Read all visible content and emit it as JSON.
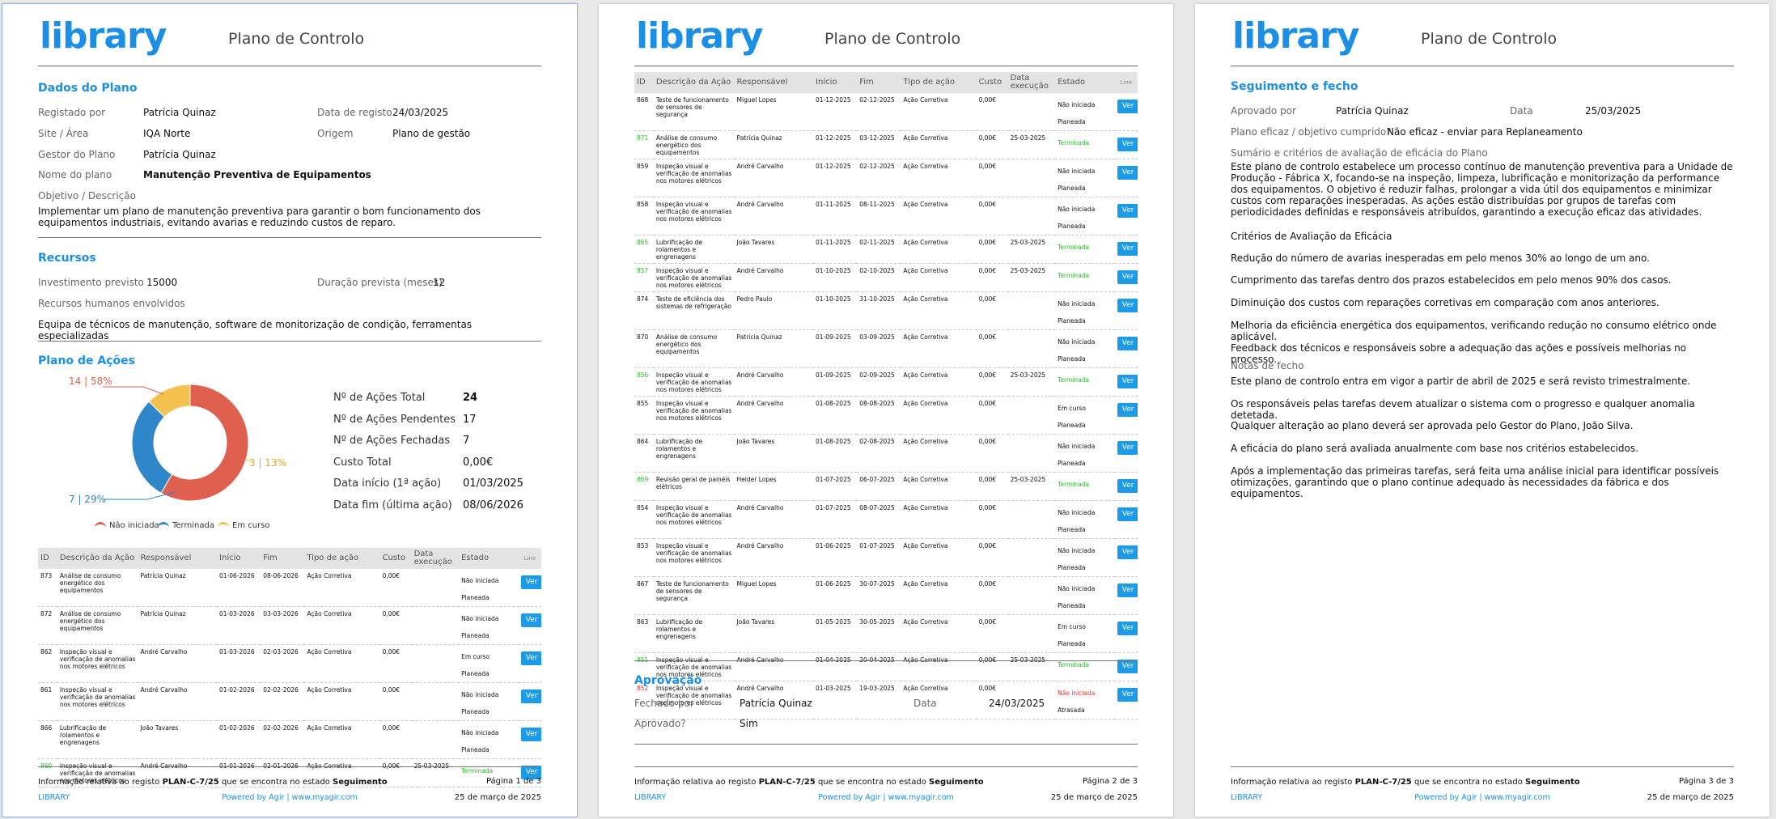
{
  "doc": {
    "logo": "library",
    "title": "Plano de Controlo",
    "footer": {
      "info_prefix": "Informação relativa ao registo ",
      "code": "PLAN-C-7/25",
      "info_mid": " que se encontra no estado ",
      "state": "Seguimento",
      "lib": "LIBRARY",
      "powered": "Powered by Agir | www.myagir.com",
      "date": "25 de março de 2025",
      "pages": [
        "Página 1 de 3",
        "Página 2 de 3",
        "Página 3 de 3"
      ]
    }
  },
  "dados": {
    "title": "Dados do Plano",
    "registado_por_label": "Registado por",
    "registado_por": "Patrícia Quinaz",
    "data_registo_label": "Data de registo",
    "data_registo": "24/03/2025",
    "site_label": "Site / Área",
    "site": "IQA Norte",
    "origem_label": "Origem",
    "origem": "Plano de gestão",
    "gestor_label": "Gestor do Plano",
    "gestor": "Patrícia Quinaz",
    "nome_label": "Nome do plano",
    "nome": "Manutenção Preventiva de Equipamentos",
    "objetivo_label": "Objetivo / Descrição",
    "objetivo": "Implementar um plano de manutenção preventiva para garantir o bom funcionamento dos equipamentos industriais, evitando avarias e reduzindo custos de reparo."
  },
  "recursos": {
    "title": "Recursos",
    "investimento_label": "Investimento previsto",
    "investimento": "15000",
    "duracao_label": "Duração prevista (meses)",
    "duracao": "12",
    "humanos_label": "Recursos humanos envolvidos",
    "humanos": "Equipa de técnicos de manutenção, software de monitorização de condição, ferramentas especializadas"
  },
  "plano_acoes": {
    "title": "Plano de Ações",
    "stats": [
      {
        "label": "Nº de Ações Total",
        "value": "24"
      },
      {
        "label": "Nº de Ações Pendentes",
        "value": "17"
      },
      {
        "label": "Nº de Ações Fechadas",
        "value": "7"
      },
      {
        "label": "Custo Total",
        "value": "0,00€"
      },
      {
        "label": "Data início (1ª ação)",
        "value": "01/03/2025"
      },
      {
        "label": "Data fim (última ação)",
        "value": "08/06/2026"
      }
    ],
    "legend": [
      "Não iniciada",
      "Terminada",
      "Em curso"
    ]
  },
  "chart_data": {
    "type": "pie",
    "categories": [
      "Não iniciada",
      "Terminada",
      "Em curso"
    ],
    "values": [
      14,
      7,
      3
    ],
    "labels": [
      "14 | 58%",
      "7 | 29%",
      "3 | 13%"
    ],
    "colors": [
      "#e0604f",
      "#2f86c8",
      "#f2c14e"
    ]
  },
  "table": {
    "headers": [
      "ID",
      "Descrição da Ação",
      "Responsável",
      "Início",
      "Fim",
      "Tipo de ação",
      "Custo",
      "Data execução",
      "Estado",
      "Line"
    ],
    "button": "Ver",
    "rows_p1": [
      {
        "id": "873",
        "desc": "Análise de consumo energético dos equipamentos",
        "resp": "Patrícia Quinaz",
        "ini": "01-06-2026",
        "fim": "08-06-2026",
        "tipo": "Ação Corretiva",
        "custo": "0,00€",
        "exec": "",
        "estado": "Não iniciada",
        "sub": "Planeada",
        "cls": ""
      },
      {
        "id": "872",
        "desc": "Análise de consumo energético dos equipamentos",
        "resp": "Patrícia Quinaz",
        "ini": "01-03-2026",
        "fim": "03-03-2026",
        "tipo": "Ação Corretiva",
        "custo": "0,00€",
        "exec": "",
        "estado": "Não iniciada",
        "sub": "Planeada",
        "cls": ""
      },
      {
        "id": "862",
        "desc": "Inspeção visual e verificação de anomalias nos motores elétricos",
        "resp": "André Carvalho",
        "ini": "01-03-2026",
        "fim": "02-03-2026",
        "tipo": "Ação Corretiva",
        "custo": "0,00€",
        "exec": "",
        "estado": "Em curso",
        "sub": "Planeada",
        "cls": ""
      },
      {
        "id": "861",
        "desc": "Inspeção visual e verificação de anomalias nos motores elétricos",
        "resp": "André Carvalho",
        "ini": "01-02-2026",
        "fim": "02-02-2026",
        "tipo": "Ação Corretiva",
        "custo": "0,00€",
        "exec": "",
        "estado": "Não iniciada",
        "sub": "Planeada",
        "cls": ""
      },
      {
        "id": "866",
        "desc": "Lubrificação de rolamentos e engrenagens",
        "resp": "João Tavares",
        "ini": "01-02-2026",
        "fim": "02-02-2026",
        "tipo": "Ação Corretiva",
        "custo": "0,00€",
        "exec": "",
        "estado": "Não iniciada",
        "sub": "Planeada",
        "cls": ""
      },
      {
        "id": "860",
        "desc": "Inspeção visual e verificação de anomalias nos motores elétricos",
        "resp": "André Carvalho",
        "ini": "01-01-2026",
        "fim": "02-01-2026",
        "tipo": "Ação Corretiva",
        "custo": "0,00€",
        "exec": "25-03-2025",
        "estado": "Terminada",
        "sub": "",
        "cls": "green"
      }
    ],
    "rows_p2": [
      {
        "id": "868",
        "desc": "Teste de funcionamento de sensores de segurança",
        "resp": "Miguel Lopes",
        "ini": "01-12-2025",
        "fim": "02-12-2025",
        "tipo": "Ação Corretiva",
        "custo": "0,00€",
        "exec": "",
        "estado": "Não iniciada",
        "sub": "Planeada",
        "cls": ""
      },
      {
        "id": "871",
        "desc": "Análise de consumo energético dos equipamentos",
        "resp": "Patrícia Quinaz",
        "ini": "01-12-2025",
        "fim": "03-12-2025",
        "tipo": "Ação Corretiva",
        "custo": "0,00€",
        "exec": "25-03-2025",
        "estado": "Terminada",
        "sub": "",
        "cls": "green"
      },
      {
        "id": "859",
        "desc": "Inspeção visual e verificação de anomalias nos motores elétricos",
        "resp": "André Carvalho",
        "ini": "01-12-2025",
        "fim": "02-12-2025",
        "tipo": "Ação Corretiva",
        "custo": "0,00€",
        "exec": "",
        "estado": "Não iniciada",
        "sub": "Planeada",
        "cls": ""
      },
      {
        "id": "858",
        "desc": "Inspeção visual e verificação de anomalias nos motores elétricos",
        "resp": "André Carvalho",
        "ini": "01-11-2025",
        "fim": "08-11-2025",
        "tipo": "Ação Corretiva",
        "custo": "0,00€",
        "exec": "",
        "estado": "Não iniciada",
        "sub": "Planeada",
        "cls": ""
      },
      {
        "id": "865",
        "desc": "Lubrificação de rolamentos e engrenagens",
        "resp": "João Tavares",
        "ini": "01-11-2025",
        "fim": "02-11-2025",
        "tipo": "Ação Corretiva",
        "custo": "0,00€",
        "exec": "25-03-2025",
        "estado": "Terminada",
        "sub": "",
        "cls": "green"
      },
      {
        "id": "857",
        "desc": "Inspeção visual e verificação de anomalias nos motores elétricos",
        "resp": "André Carvalho",
        "ini": "01-10-2025",
        "fim": "02-10-2025",
        "tipo": "Ação Corretiva",
        "custo": "0,00€",
        "exec": "25-03-2025",
        "estado": "Terminada",
        "sub": "",
        "cls": "green"
      },
      {
        "id": "874",
        "desc": "Teste de eficiência dos sistemas de refrigeração",
        "resp": "Pedro Paulo",
        "ini": "01-10-2025",
        "fim": "31-10-2025",
        "tipo": "Ação Corretiva",
        "custo": "0,00€",
        "exec": "",
        "estado": "Não iniciada",
        "sub": "Planeada",
        "cls": ""
      },
      {
        "id": "870",
        "desc": "Análise de consumo energético dos equipamentos",
        "resp": "Patrícia Quinaz",
        "ini": "01-09-2025",
        "fim": "03-09-2025",
        "tipo": "Ação Corretiva",
        "custo": "0,00€",
        "exec": "",
        "estado": "Não iniciada",
        "sub": "Planeada",
        "cls": ""
      },
      {
        "id": "856",
        "desc": "Inspeção visual e verificação de anomalias nos motores elétricos",
        "resp": "André Carvalho",
        "ini": "01-09-2025",
        "fim": "02-09-2025",
        "tipo": "Ação Corretiva",
        "custo": "0,00€",
        "exec": "25-03-2025",
        "estado": "Terminada",
        "sub": "",
        "cls": "green"
      },
      {
        "id": "855",
        "desc": "Inspeção visual e verificação de anomalias nos motores elétricos",
        "resp": "André Carvalho",
        "ini": "01-08-2025",
        "fim": "08-08-2025",
        "tipo": "Ação Corretiva",
        "custo": "0,00€",
        "exec": "",
        "estado": "Em curso",
        "sub": "Planeada",
        "cls": ""
      },
      {
        "id": "864",
        "desc": "Lubrificação de rolamentos e engrenagens",
        "resp": "João Tavares",
        "ini": "01-08-2025",
        "fim": "02-08-2025",
        "tipo": "Ação Corretiva",
        "custo": "0,00€",
        "exec": "",
        "estado": "Não iniciada",
        "sub": "Planeada",
        "cls": ""
      },
      {
        "id": "869",
        "desc": "Revisão geral de painéis elétricos",
        "resp": "Helder Lopes",
        "ini": "01-07-2025",
        "fim": "06-07-2025",
        "tipo": "Ação Corretiva",
        "custo": "0,00€",
        "exec": "25-03-2025",
        "estado": "Terminada",
        "sub": "",
        "cls": "green"
      },
      {
        "id": "854",
        "desc": "Inspeção visual e verificação de anomalias nos motores elétricos",
        "resp": "André Carvalho",
        "ini": "01-07-2025",
        "fim": "08-07-2025",
        "tipo": "Ação Corretiva",
        "custo": "0,00€",
        "exec": "",
        "estado": "Não iniciada",
        "sub": "Planeada",
        "cls": ""
      },
      {
        "id": "853",
        "desc": "Inspeção visual e verificação de anomalias nos motores elétricos",
        "resp": "André Carvalho",
        "ini": "01-06-2025",
        "fim": "01-07-2025",
        "tipo": "Ação Corretiva",
        "custo": "0,00€",
        "exec": "",
        "estado": "Não iniciada",
        "sub": "Planeada",
        "cls": ""
      },
      {
        "id": "867",
        "desc": "Teste de funcionamento de sensores de segurança",
        "resp": "Miguel Lopes",
        "ini": "01-06-2025",
        "fim": "30-07-2025",
        "tipo": "Ação Corretiva",
        "custo": "0,00€",
        "exec": "",
        "estado": "Não iniciada",
        "sub": "Planeada",
        "cls": ""
      },
      {
        "id": "863",
        "desc": "Lubrificação de rolamentos e engrenagens",
        "resp": "João Tavares",
        "ini": "01-05-2025",
        "fim": "30-05-2025",
        "tipo": "Ação Corretiva",
        "custo": "0,00€",
        "exec": "",
        "estado": "Em curso",
        "sub": "Planeada",
        "cls": ""
      },
      {
        "id": "851",
        "desc": "Inspeção visual e verificação de anomalias nos motores elétricos",
        "resp": "André Carvalho",
        "ini": "01-04-2025",
        "fim": "20-04-2025",
        "tipo": "Ação Corretiva",
        "custo": "0,00€",
        "exec": "25-03-2025",
        "estado": "Terminada",
        "sub": "",
        "cls": "green"
      },
      {
        "id": "852",
        "desc": "Inspeção visual e verificação de anomalias nos motores elétricos",
        "resp": "André Carvalho",
        "ini": "01-03-2025",
        "fim": "19-03-2025",
        "tipo": "Ação Corretiva",
        "custo": "0,00€",
        "exec": "",
        "estado": "Não iniciada",
        "sub": "Atrasada",
        "cls": "red"
      }
    ]
  },
  "aprovacao": {
    "title": "Aprovação",
    "fechado_label": "Fechado por",
    "fechado": "Patrícia Quinaz",
    "data_label": "Data",
    "data": "24/03/2025",
    "aprovado_label": "Aprovado?",
    "aprovado": "Sim"
  },
  "seguimento": {
    "title": "Seguimento e fecho",
    "aprovado_por_label": "Aprovado por",
    "aprovado_por": "Patrícia Quinaz",
    "data_label": "Data",
    "data": "25/03/2025",
    "eficaz_label": "Plano eficaz / objetivo cumprido?",
    "eficaz": "Não eficaz - enviar para Replaneamento",
    "sumario_label": "Sumário e critérios de avaliação de eficácia do Plano",
    "sumario": "Este plano de controlo estabelece um processo contínuo de manutenção preventiva para a Unidade de Produção - Fábrica X, focando-se na inspeção, limpeza, lubrificação e monitorização da performance dos equipamentos. O objetivo é reduzir falhas, prolongar a vida útil dos equipamentos e minimizar custos com reparações inesperadas. As ações estão distribuídas por grupos de tarefas com periodicidades definidas e responsáveis atribuídos, garantindo a execução eficaz das atividades.",
    "criterios_title": "Critérios de Avaliação da Eficácia",
    "criterios": [
      "Redução do número de avarias inesperadas em pelo menos 30% ao longo de um ano.",
      "Cumprimento das tarefas dentro dos prazos estabelecidos em pelo menos 90% dos casos.",
      "Diminuição dos custos com reparações corretivas em comparação com anos anteriores.",
      "Melhoria da eficiência energética dos equipamentos, verificando redução no consumo elétrico onde aplicável.",
      "Feedback dos técnicos e responsáveis sobre a adequação das ações e possíveis melhorias no processo."
    ],
    "notas_label": "Notas de fecho",
    "notas": [
      "Este plano de controlo entra em vigor a partir de abril de 2025 e será revisto trimestralmente.",
      "Os responsáveis pelas tarefas devem atualizar o sistema com o progresso e qualquer anomalia detetada.",
      "Qualquer alteração ao plano deverá ser aprovada pelo Gestor do Plano, João Silva.",
      "A eficácia do plano será avaliada anualmente com base nos critérios estabelecidos.",
      "Após a implementação das primeiras tarefas, será feita uma análise inicial para identificar possíveis otimizações, garantindo que o plano continue adequado às necessidades da fábrica e dos equipamentos."
    ]
  }
}
